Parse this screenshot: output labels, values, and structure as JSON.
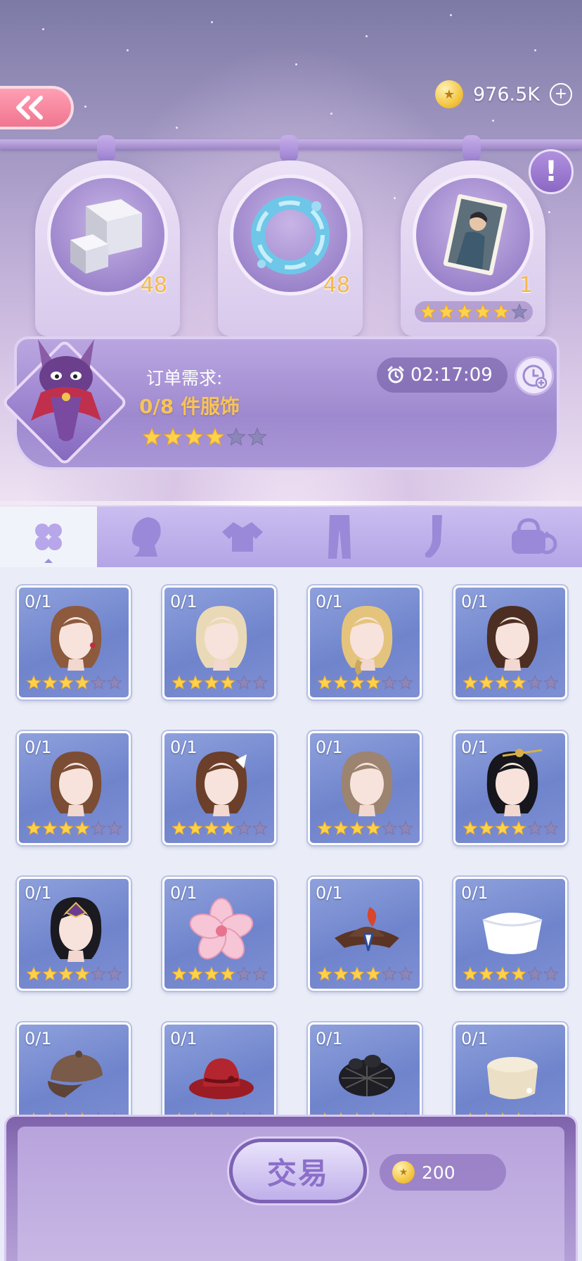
{
  "header": {
    "back_icon": "double-chevron-left-icon",
    "currency": {
      "icon": "coin-icon",
      "value": "976.5K",
      "add_icon": "plus-icon"
    }
  },
  "reward_items": [
    {
      "name": "crystal-cubes",
      "count": "48"
    },
    {
      "name": "water-ring",
      "count": "48"
    },
    {
      "name": "character-card",
      "count": "1",
      "stars": 5,
      "max_stars": 6
    }
  ],
  "info_icon": "exclamation-icon",
  "order": {
    "label": "订单需求:",
    "progress": "0/8 件服饰",
    "stars": 4,
    "max_stars": 6,
    "timer": "02:17:09",
    "timer_icon": "alarm-clock-icon",
    "speedup_icon": "clock-plus-icon"
  },
  "tabs": [
    {
      "icon": "clover-icon",
      "active": true
    },
    {
      "icon": "hair-icon",
      "active": false
    },
    {
      "icon": "top-icon",
      "active": false
    },
    {
      "icon": "pants-icon",
      "active": false
    },
    {
      "icon": "foot-icon",
      "active": false
    },
    {
      "icon": "accessory-bag-icon",
      "active": false
    }
  ],
  "items": [
    {
      "count": "0/1",
      "art": "brown-curly-hair",
      "stars": 4
    },
    {
      "count": "0/1",
      "art": "blonde-wavy-hair",
      "stars": 4
    },
    {
      "count": "0/1",
      "art": "blonde-braid-hair",
      "stars": 4
    },
    {
      "count": "0/1",
      "art": "brown-ponytail-hair",
      "stars": 4
    },
    {
      "count": "0/1",
      "art": "brown-bob-hair",
      "stars": 4
    },
    {
      "count": "0/1",
      "art": "bow-updo-hair",
      "stars": 4
    },
    {
      "count": "0/1",
      "art": "ash-curly-hair",
      "stars": 4
    },
    {
      "count": "0/1",
      "art": "black-hairpin-updo",
      "stars": 4
    },
    {
      "count": "0/1",
      "art": "black-crown-updo",
      "stars": 4
    },
    {
      "count": "0/1",
      "art": "pink-flower",
      "stars": 4
    },
    {
      "count": "0/1",
      "art": "feather-tricorn-hat",
      "stars": 4
    },
    {
      "count": "0/1",
      "art": "white-nurse-cap",
      "stars": 4
    },
    {
      "count": "0/1",
      "art": "brown-newsboy-cap",
      "stars": 4
    },
    {
      "count": "0/1",
      "art": "red-bow-hat",
      "stars": 4
    },
    {
      "count": "0/1",
      "art": "black-hairnet",
      "stars": 4
    },
    {
      "count": "0/1",
      "art": "cream-pillbox-hat",
      "stars": 4
    }
  ],
  "item_max_stars": 6,
  "footer": {
    "trade_label": "交易",
    "price_icon": "coin-icon",
    "price": "200"
  }
}
